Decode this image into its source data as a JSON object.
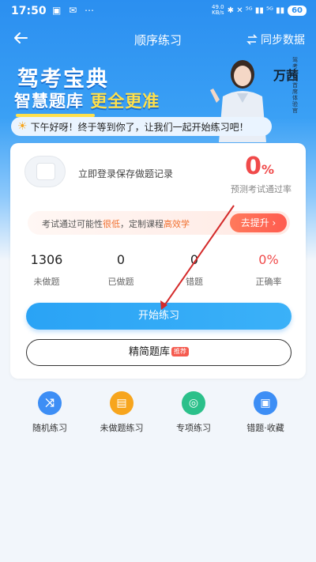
{
  "status_bar": {
    "time": "17:50",
    "left_icons": "▣ ✉ ⋯",
    "speed_top": "49.0",
    "speed_bottom": "KB/s",
    "right_icons": "✱ ✕ ⁵ᴳ ▮▮ ⁵ᴳ ▮▮",
    "battery": "60"
  },
  "navbar": {
    "back_icon": "back-arrow-icon",
    "title": "顺序练习",
    "sync_label": "同步数据"
  },
  "banner": {
    "title": "驾考宝典",
    "subtitle_part1": "智慧题库",
    "subtitle_part2": "更全更准",
    "person_name": "万茜",
    "person_title": "驾考宝典首席体验官"
  },
  "greeting": "下午好呀！终于等到你了，让我们一起开始练习吧！",
  "card": {
    "login_text": "立即登录保存做题记录",
    "pass_rate_value": "0",
    "pass_rate_unit": "%",
    "pass_rate_label": "预测考试通过率",
    "tip_prefix": "考试通过可能性",
    "tip_low": "很低",
    "tip_mid": "，定制课程",
    "tip_eff": "高效学",
    "boost_button": "去提升 ›",
    "stats": [
      {
        "value": "1306",
        "label": "未做题"
      },
      {
        "value": "0",
        "label": "已做题"
      },
      {
        "value": "0",
        "label": "错题"
      },
      {
        "value": "0%",
        "label": "正确率"
      }
    ],
    "start_button": "开始练习",
    "simple_button": "精简题库",
    "simple_badge": "推荐"
  },
  "shortcuts": [
    {
      "label": "随机练习",
      "icon": "shuffle-icon",
      "color": "#3d8ef5"
    },
    {
      "label": "未做题练习",
      "icon": "document-icon",
      "color": "#f7a51d"
    },
    {
      "label": "专项练习",
      "icon": "target-icon",
      "color": "#2bc08a"
    },
    {
      "label": "错题·收藏",
      "icon": "bookmark-icon",
      "color": "#3d8ef5"
    }
  ],
  "colors": {
    "primary": "#2b8ff0",
    "accent_red": "#f04a4a",
    "banner_yellow": "#ffe04a"
  }
}
